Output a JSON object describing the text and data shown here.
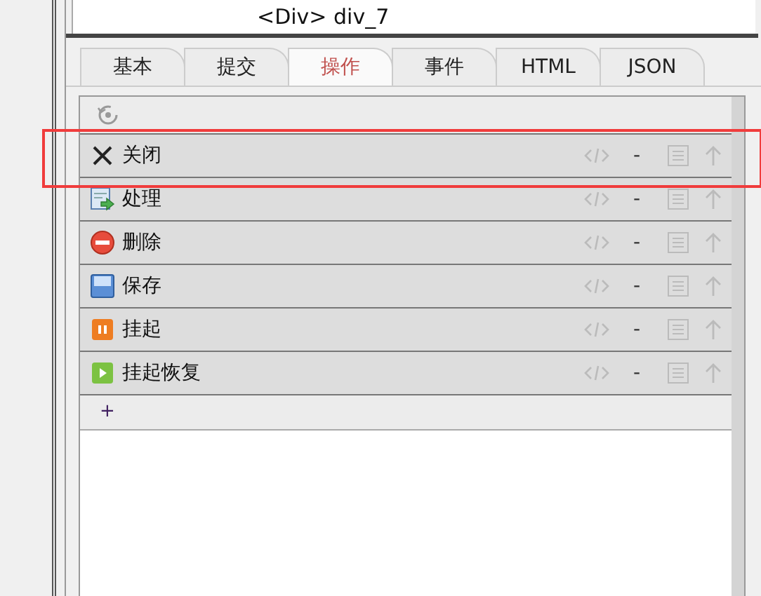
{
  "tree": {
    "node_label": "<Div> div_7"
  },
  "tabs": [
    {
      "label": "基本",
      "selected": false
    },
    {
      "label": "提交",
      "selected": false
    },
    {
      "label": "操作",
      "selected": true
    },
    {
      "label": "事件",
      "selected": false
    },
    {
      "label": "HTML",
      "selected": false
    },
    {
      "label": "JSON",
      "selected": false
    }
  ],
  "actions": [
    {
      "kind": "close",
      "label": "关闭",
      "value": "-",
      "highlighted": true
    },
    {
      "kind": "process",
      "label": "处理",
      "value": "-",
      "highlighted": false
    },
    {
      "kind": "delete",
      "label": "删除",
      "value": "-",
      "highlighted": false
    },
    {
      "kind": "save",
      "label": "保存",
      "value": "-",
      "highlighted": false
    },
    {
      "kind": "pause",
      "label": "挂起",
      "value": "-",
      "highlighted": false
    },
    {
      "kind": "resume",
      "label": "挂起恢复",
      "value": "-",
      "highlighted": false
    }
  ],
  "add_button": "+"
}
